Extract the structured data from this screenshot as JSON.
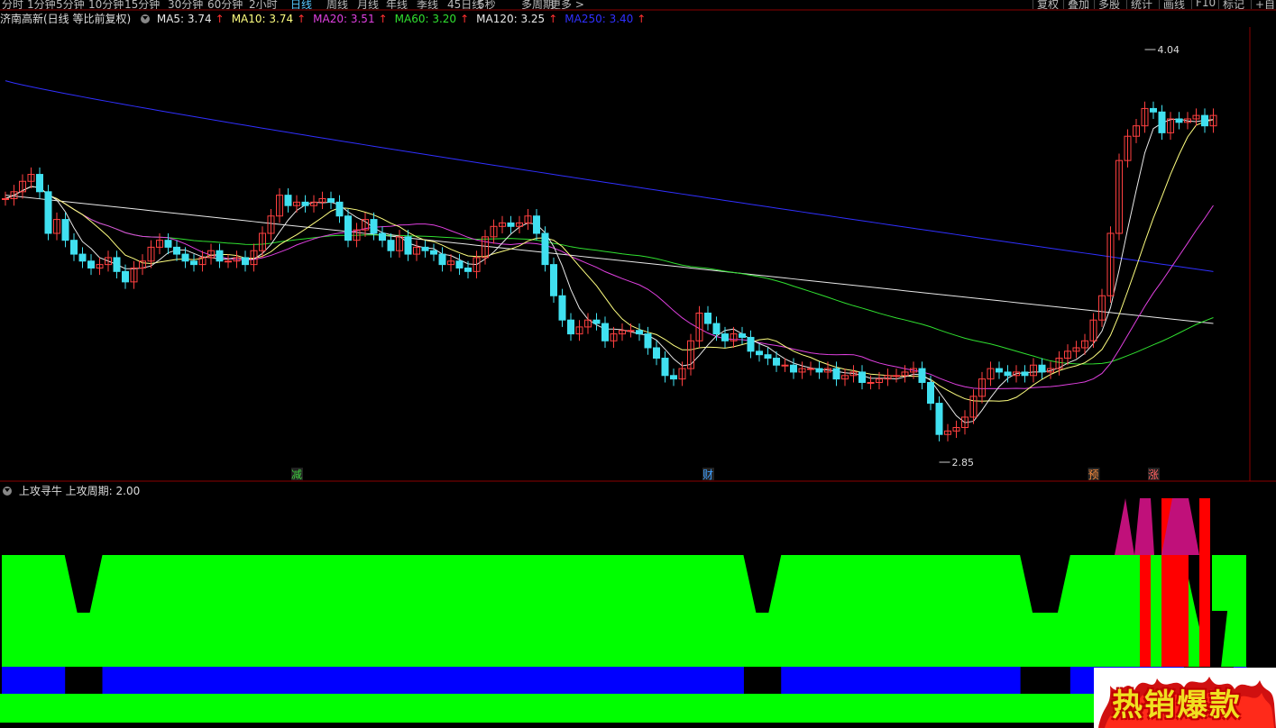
{
  "toolbar": {
    "periods": [
      "分时",
      "1分钟",
      "5分钟",
      "10分钟",
      "15分钟",
      "30分钟",
      "60分钟",
      "2小时",
      "日线",
      "周线",
      "月线",
      "年线",
      "季线",
      "45日线",
      "5秒",
      "多周期",
      "更多 >"
    ],
    "active": "日线",
    "right_buttons": [
      "复权",
      "叠加",
      "多股",
      "统计",
      "画线",
      "F10",
      "标记",
      "+自"
    ]
  },
  "main_header": {
    "title": "济南高新(日线 等比前复权)",
    "ma": [
      {
        "label": "MA5: 3.74",
        "arrow": "↑",
        "color": "#e8e8e8"
      },
      {
        "label": "MA10: 3.74",
        "arrow": "↑",
        "color": "#ffff80"
      },
      {
        "label": "MA20: 3.51",
        "arrow": "↑",
        "color": "#e040e0"
      },
      {
        "label": "MA60: 3.20",
        "arrow": "↑",
        "color": "#30e030"
      },
      {
        "label": "MA120: 3.25",
        "arrow": "↑",
        "color": "#e8e8e8"
      },
      {
        "label": "MA250: 3.40",
        "arrow": "↑",
        "color": "#3030ff"
      }
    ]
  },
  "annotations": {
    "high_label": "4.04",
    "low_label": "2.85",
    "markers": [
      {
        "text": "减",
        "color": "#40d040"
      },
      {
        "text": "财",
        "color": "#40a0ff"
      },
      {
        "text": "预",
        "color": "#ff9040"
      },
      {
        "text": "涨",
        "color": "#ff6060"
      }
    ]
  },
  "sub_header": {
    "title": "上攻寻牛",
    "param": "上攻周期: 2.00"
  },
  "badge": {
    "text": "热销爆款"
  },
  "colors": {
    "up": "#ff4040",
    "down": "#40e0f0",
    "green_band": "#00ff00",
    "blue_band": "#0000ff",
    "red_bar": "#ff0000",
    "magenta": "#c0107a"
  },
  "chart_data": [
    {
      "type": "candlestick",
      "title": "济南高新(日线 等比前复权)",
      "y_range": [
        2.85,
        4.04
      ],
      "high": 4.04,
      "low": 2.85,
      "moving_averages": {
        "MA5": 3.74,
        "MA10": 3.74,
        "MA20": 3.51,
        "MA60": 3.2,
        "MA120": 3.25,
        "MA250": 3.4
      },
      "closes": [
        3.61,
        3.63,
        3.66,
        3.68,
        3.63,
        3.51,
        3.55,
        3.49,
        3.45,
        3.43,
        3.41,
        3.42,
        3.44,
        3.4,
        3.37,
        3.41,
        3.43,
        3.47,
        3.49,
        3.47,
        3.45,
        3.43,
        3.42,
        3.44,
        3.46,
        3.43,
        3.43,
        3.44,
        3.42,
        3.46,
        3.51,
        3.56,
        3.62,
        3.59,
        3.6,
        3.59,
        3.6,
        3.61,
        3.6,
        3.56,
        3.49,
        3.52,
        3.55,
        3.51,
        3.49,
        3.46,
        3.5,
        3.45,
        3.47,
        3.46,
        3.45,
        3.42,
        3.43,
        3.41,
        3.4,
        3.44,
        3.5,
        3.53,
        3.54,
        3.53,
        3.54,
        3.56,
        3.51,
        3.42,
        3.33,
        3.26,
        3.22,
        3.24,
        3.26,
        3.25,
        3.2,
        3.22,
        3.23,
        3.23,
        3.22,
        3.18,
        3.15,
        3.1,
        3.09,
        3.12,
        3.2,
        3.28,
        3.25,
        3.22,
        3.2,
        3.22,
        3.21,
        3.17,
        3.16,
        3.15,
        3.13,
        3.13,
        3.11,
        3.12,
        3.12,
        3.11,
        3.12,
        3.09,
        3.1,
        3.11,
        3.08,
        3.08,
        3.09,
        3.1,
        3.1,
        3.11,
        3.12,
        3.08,
        3.02,
        2.93,
        2.94,
        2.95,
        2.98,
        3.04,
        3.09,
        3.12,
        3.11,
        3.1,
        3.11,
        3.1,
        3.13,
        3.11,
        3.12,
        3.15,
        3.17,
        3.18,
        3.2,
        3.26,
        3.33,
        3.51,
        3.72,
        3.79,
        3.82,
        3.87,
        3.86,
        3.8,
        3.84,
        3.83,
        3.84,
        3.85,
        3.82,
        3.85
      ]
    },
    {
      "type": "area",
      "title": "上攻寻牛",
      "param": "上攻周期: 2.00",
      "series": [
        {
          "name": "band",
          "levels": [
            2,
            2,
            2,
            1,
            1,
            1,
            0.5,
            0.5,
            1,
            1,
            1,
            1,
            1,
            1,
            1,
            1,
            1,
            1,
            1,
            1,
            1,
            1,
            1,
            1,
            1,
            1,
            1,
            1,
            1,
            1,
            1,
            1,
            1,
            1,
            1,
            1,
            1,
            1,
            1,
            1,
            1,
            1,
            1,
            1,
            1,
            1,
            1,
            1,
            1,
            1,
            1,
            1,
            1,
            1,
            1,
            1,
            1,
            1,
            1,
            1,
            0.5,
            0.5,
            1,
            1,
            1,
            1,
            1,
            1,
            1,
            1,
            1,
            1,
            1,
            1,
            1,
            1,
            1,
            1,
            1,
            1,
            1,
            1,
            0.5,
            0.5,
            0.5,
            1,
            1,
            1,
            1,
            1,
            1,
            1,
            1,
            1,
            1,
            0.5,
            0,
            0,
            2,
            2
          ]
        }
      ]
    }
  ]
}
